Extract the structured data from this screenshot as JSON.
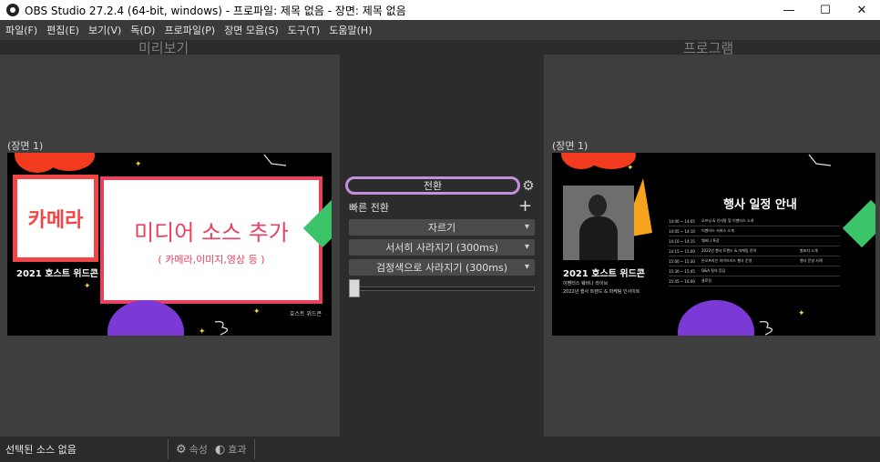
{
  "window": {
    "title": "OBS Studio 27.2.4 (64-bit, windows) - 프로파일: 제목 없음 - 장면: 제목 없음",
    "minimize": "—",
    "maximize": "☐",
    "close": "✕"
  },
  "menu": [
    "파일(F)",
    "편집(E)",
    "보기(V)",
    "독(D)",
    "프로파일(P)",
    "장면 모음(S)",
    "도구(T)",
    "도움말(H)"
  ],
  "preview": {
    "title": "미리보기",
    "scene_label": "(장면 1)",
    "camera_text": "카메라",
    "event_text": "2021 호스트 위드콘",
    "media_title": "미디어 소스 추가",
    "media_sub": "( 카메라,이미지,영상 등 )",
    "corner_logo": "호스트 위드콘"
  },
  "program": {
    "title": "프로그램",
    "scene_label": "(장면 1)",
    "schedule_title": "행사 일정 안내",
    "event_text": "2021 호스트 위드콘",
    "event_sub1": "이벤터스 웨비나 라이브",
    "event_sub2": "2022년 행사 트렌드 & 마케팅 인사이트",
    "schedule_rows": [
      {
        "time": "14:00 ~ 14:05",
        "item": "오프닝 & 인사말 및 이벤터스 소개"
      },
      {
        "time": "14:05 ~ 14:10",
        "item": "이벤터스 서비스 소개"
      },
      {
        "time": "14:10 ~ 14:15",
        "item": "웨비나 특강"
      },
      {
        "time": "14:15 ~ 15:00",
        "item": "2022년 행사 트렌드 & 마케팅 전략",
        "note": "발표자 소개"
      },
      {
        "time": "15:00 ~ 15:30",
        "item": "온오프라인 하이브리드 행사 운영",
        "note": "행사 운영 사례"
      },
      {
        "time": "15:30 ~ 15:45",
        "item": "Q&A 질의 응답"
      },
      {
        "time": "15:45 ~ 16:00",
        "item": "클로징"
      }
    ]
  },
  "transitions": {
    "transition_button": "전환",
    "quick_label": "빠른 전환",
    "buttons": [
      "자르기",
      "서서히 사라지기 (300ms)",
      "검정색으로 사라지기 (300ms)"
    ],
    "slider_value_fraction": 0
  },
  "status": {
    "text": "선택된 소스 없음",
    "properties": "속성",
    "filters": "효과"
  },
  "colors": {
    "accent_border": "#c48fdc",
    "preview_red": "#f24646",
    "preview_pink": "#e9405f",
    "art_purple": "#7b3ad6",
    "art_green": "#3cc46a",
    "art_orange": "#f7a21b",
    "art_yellow": "#f5d23a"
  }
}
